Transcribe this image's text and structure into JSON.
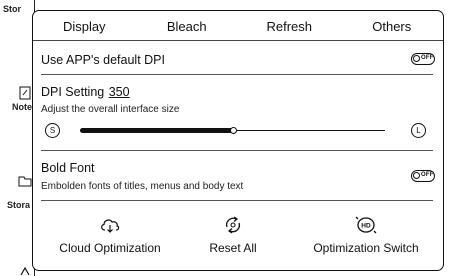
{
  "background": {
    "labels": [
      "Stor",
      "Note",
      "Stora"
    ],
    "icons": [
      "note-icon",
      "folder-icon",
      "share-icon"
    ]
  },
  "tabs": [
    {
      "label": "Display"
    },
    {
      "label": "Bleach"
    },
    {
      "label": "Refresh"
    },
    {
      "label": "Others"
    }
  ],
  "default_dpi": {
    "title": "Use APP's default DPI",
    "toggle_text": "OFF",
    "enabled": false
  },
  "dpi": {
    "title": "DPI Setting",
    "value": "350",
    "subtitle": "Adjust the overall interface size",
    "small_label": "S",
    "large_label": "L",
    "level": 0.5
  },
  "bold_font": {
    "title": "Bold Font",
    "subtitle": "Embolden fonts of titles, menus and body text",
    "toggle_text": "OFF",
    "enabled": false
  },
  "actions": [
    {
      "label": "Cloud Optimization",
      "icon": "cloud-download-icon"
    },
    {
      "label": "Reset All",
      "icon": "reset-icon"
    },
    {
      "label": "Optimization Switch",
      "icon": "hd-switch-icon"
    }
  ]
}
